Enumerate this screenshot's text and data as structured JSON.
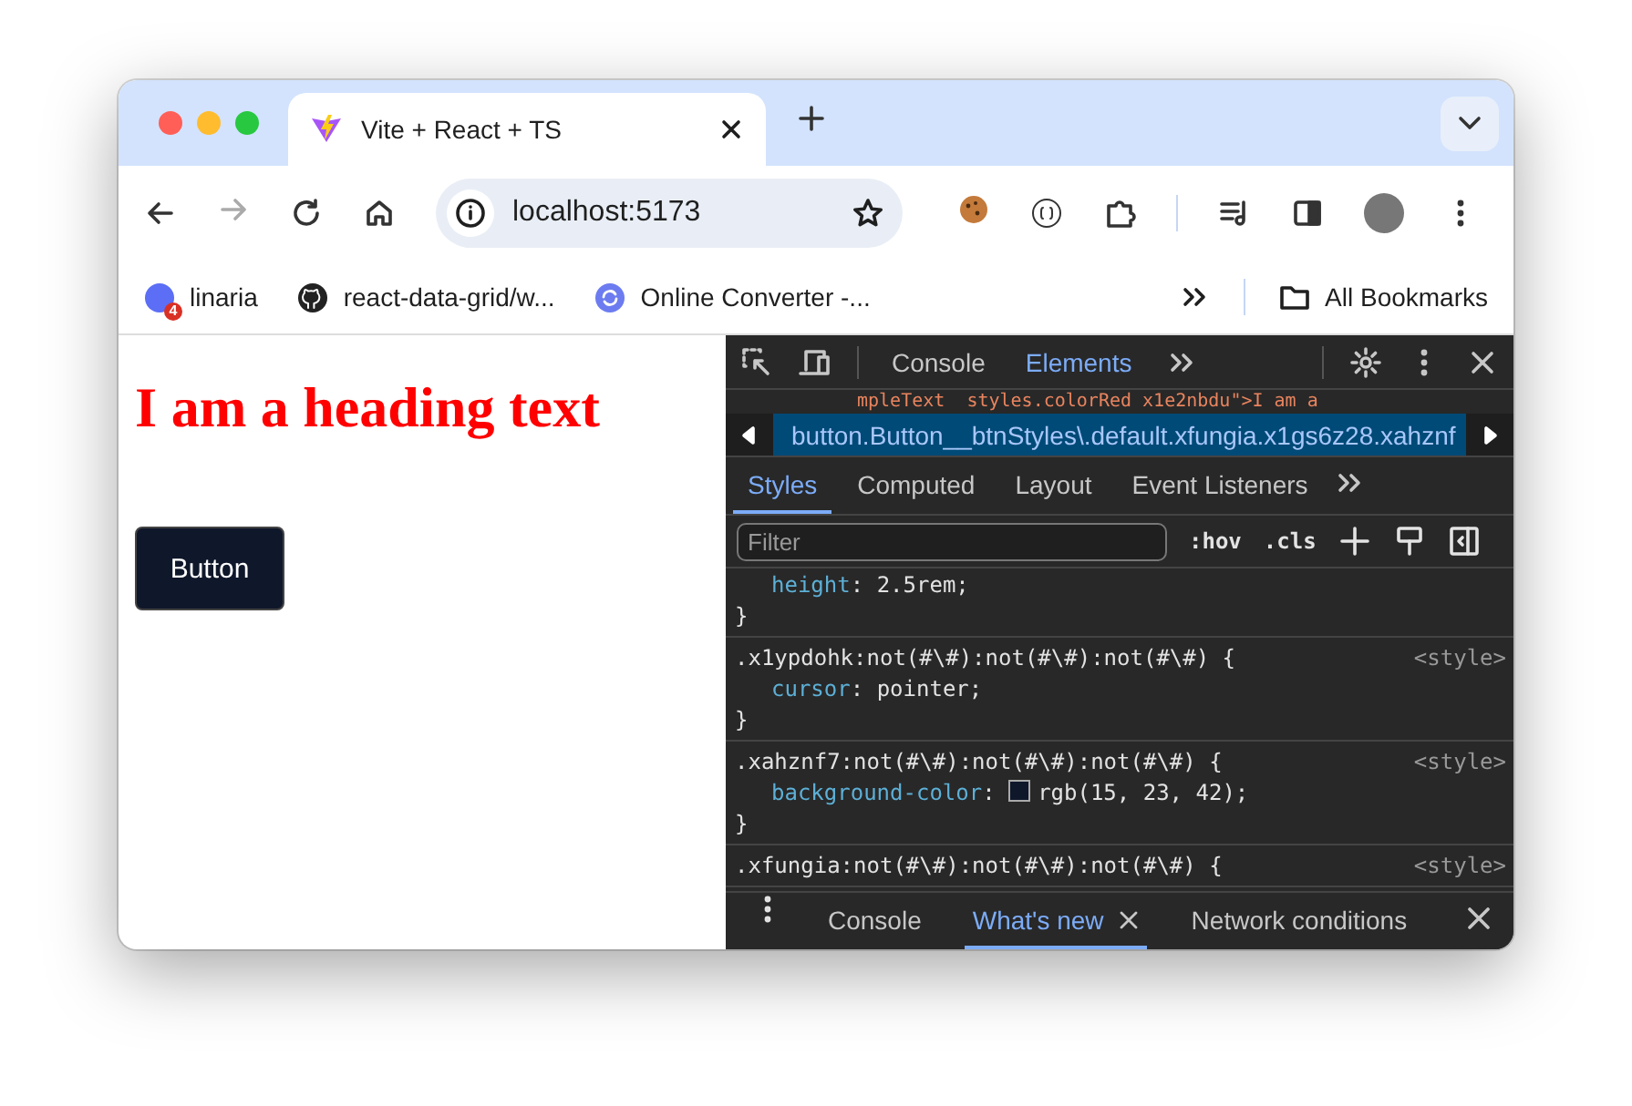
{
  "browser": {
    "tab": {
      "title": "Vite + React + TS"
    },
    "address": "localhost:5173",
    "bookmarks": [
      {
        "label": "linaria",
        "badge": "4",
        "kind": "app"
      },
      {
        "label": "react-data-grid/w...",
        "kind": "github"
      },
      {
        "label": "Online Converter -...",
        "kind": "sync"
      }
    ],
    "all_bookmarks": "All Bookmarks"
  },
  "page": {
    "heading": "I am a heading text",
    "button": "Button"
  },
  "devtools": {
    "tabs": [
      {
        "label": "Console",
        "selected": false
      },
      {
        "label": "Elements",
        "selected": true
      }
    ],
    "dom_line": "mpleText  styles.colorRed x1e2nbdu\">I am a",
    "breadcrumb": "button.Button__btnStyles\\.default.xfungia.x1gs6z28.xahznf",
    "style_tabs": [
      {
        "label": "Styles",
        "selected": true
      },
      {
        "label": "Computed",
        "selected": false
      },
      {
        "label": "Layout",
        "selected": false
      },
      {
        "label": "Event Listeners",
        "selected": false
      }
    ],
    "filter": {
      "placeholder": "Filter"
    },
    "hov": ":hov",
    "cls": ".cls",
    "rules": [
      {
        "declarations": [
          {
            "property": "height",
            "colon": ":",
            "value": "2.5rem;"
          }
        ],
        "close": "}"
      },
      {
        "selector": ".x1ypdohk:not(#\\#):not(#\\#):not(#\\#) {",
        "source": "<style>",
        "declarations": [
          {
            "property": "cursor",
            "colon": ":",
            "value": "pointer;"
          }
        ],
        "close": "}"
      },
      {
        "selector": ".xahznf7:not(#\\#):not(#\\#):not(#\\#) {",
        "source": "<style>",
        "declarations": [
          {
            "property": "background-color",
            "colon": ":",
            "value": "rgb(15, 23, 42);",
            "color": "#0f172a"
          }
        ],
        "close": "}"
      },
      {
        "selector": ".xfungia:not(#\\#):not(#\\#):not(#\\#) {",
        "source": "<style>"
      }
    ],
    "drawer_tabs": [
      {
        "label": "Console",
        "selected": false,
        "closable": false
      },
      {
        "label": "What's new",
        "selected": true,
        "closable": true
      },
      {
        "label": "Network conditions",
        "selected": false,
        "closable": false
      }
    ]
  }
}
